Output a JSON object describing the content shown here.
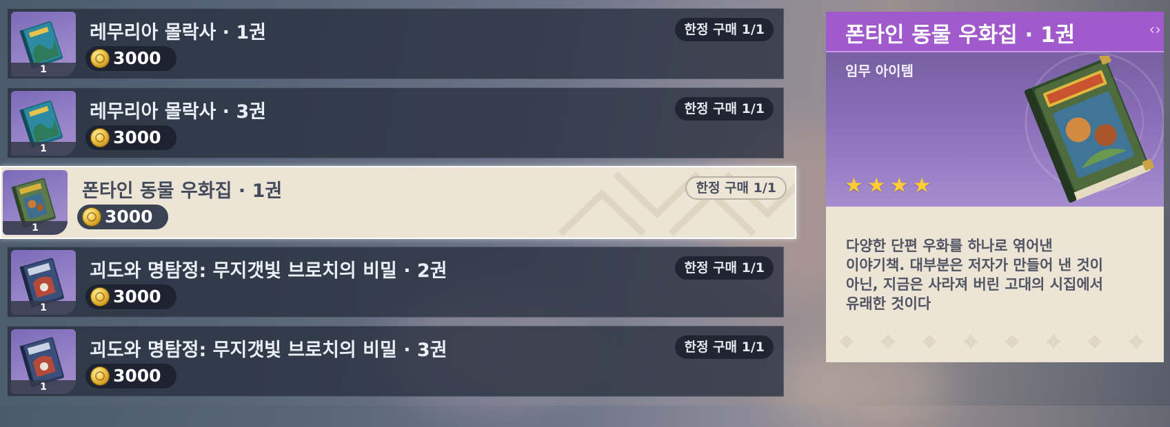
{
  "shop_items": [
    {
      "title": "레무리아 몰락사 · 1권",
      "price": "3000",
      "limit": "한정 구매 1/1",
      "quantity": "1",
      "book_icon": "teal-book-icon",
      "selected": false
    },
    {
      "title": "레무리아 몰락사 · 3권",
      "price": "3000",
      "limit": "한정 구매 1/1",
      "quantity": "1",
      "book_icon": "teal-book-icon",
      "selected": false
    },
    {
      "title": "폰타인 동물 우화집 · 1권",
      "price": "3000",
      "limit": "한정 구매 1/1",
      "quantity": "1",
      "book_icon": "green-book-icon",
      "selected": true
    },
    {
      "title": "괴도와 명탐정: 무지갯빛 브로치의 비밀 · 2권",
      "price": "3000",
      "limit": "한정 구매 1/1",
      "quantity": "1",
      "book_icon": "navy-book-icon",
      "selected": false
    },
    {
      "title": "괴도와 명탐정: 무지갯빛 브로치의 비밀 · 3권",
      "price": "3000",
      "limit": "한정 구매 1/1",
      "quantity": "1",
      "book_icon": "navy-book-icon",
      "selected": false
    }
  ],
  "currency_icon": "mora-coin-icon",
  "detail": {
    "title": "폰타인 동물 우화집 · 1권",
    "item_type": "임무 아이템",
    "rarity_stars": 4,
    "description_lines": [
      "다양한 단편 우화를 하나로 엮어낸",
      "이야기책. 대부분은 저자가 만들어 낸 것이",
      "아닌, 지금은 사라져 버린 고대의 시집에서",
      "유래한 것이다"
    ]
  },
  "colors": {
    "accent_purple": "#a05acb",
    "star_gold": "#ffcc33",
    "selected_bg": "#ece4d5",
    "row_bg": "#28303e"
  }
}
